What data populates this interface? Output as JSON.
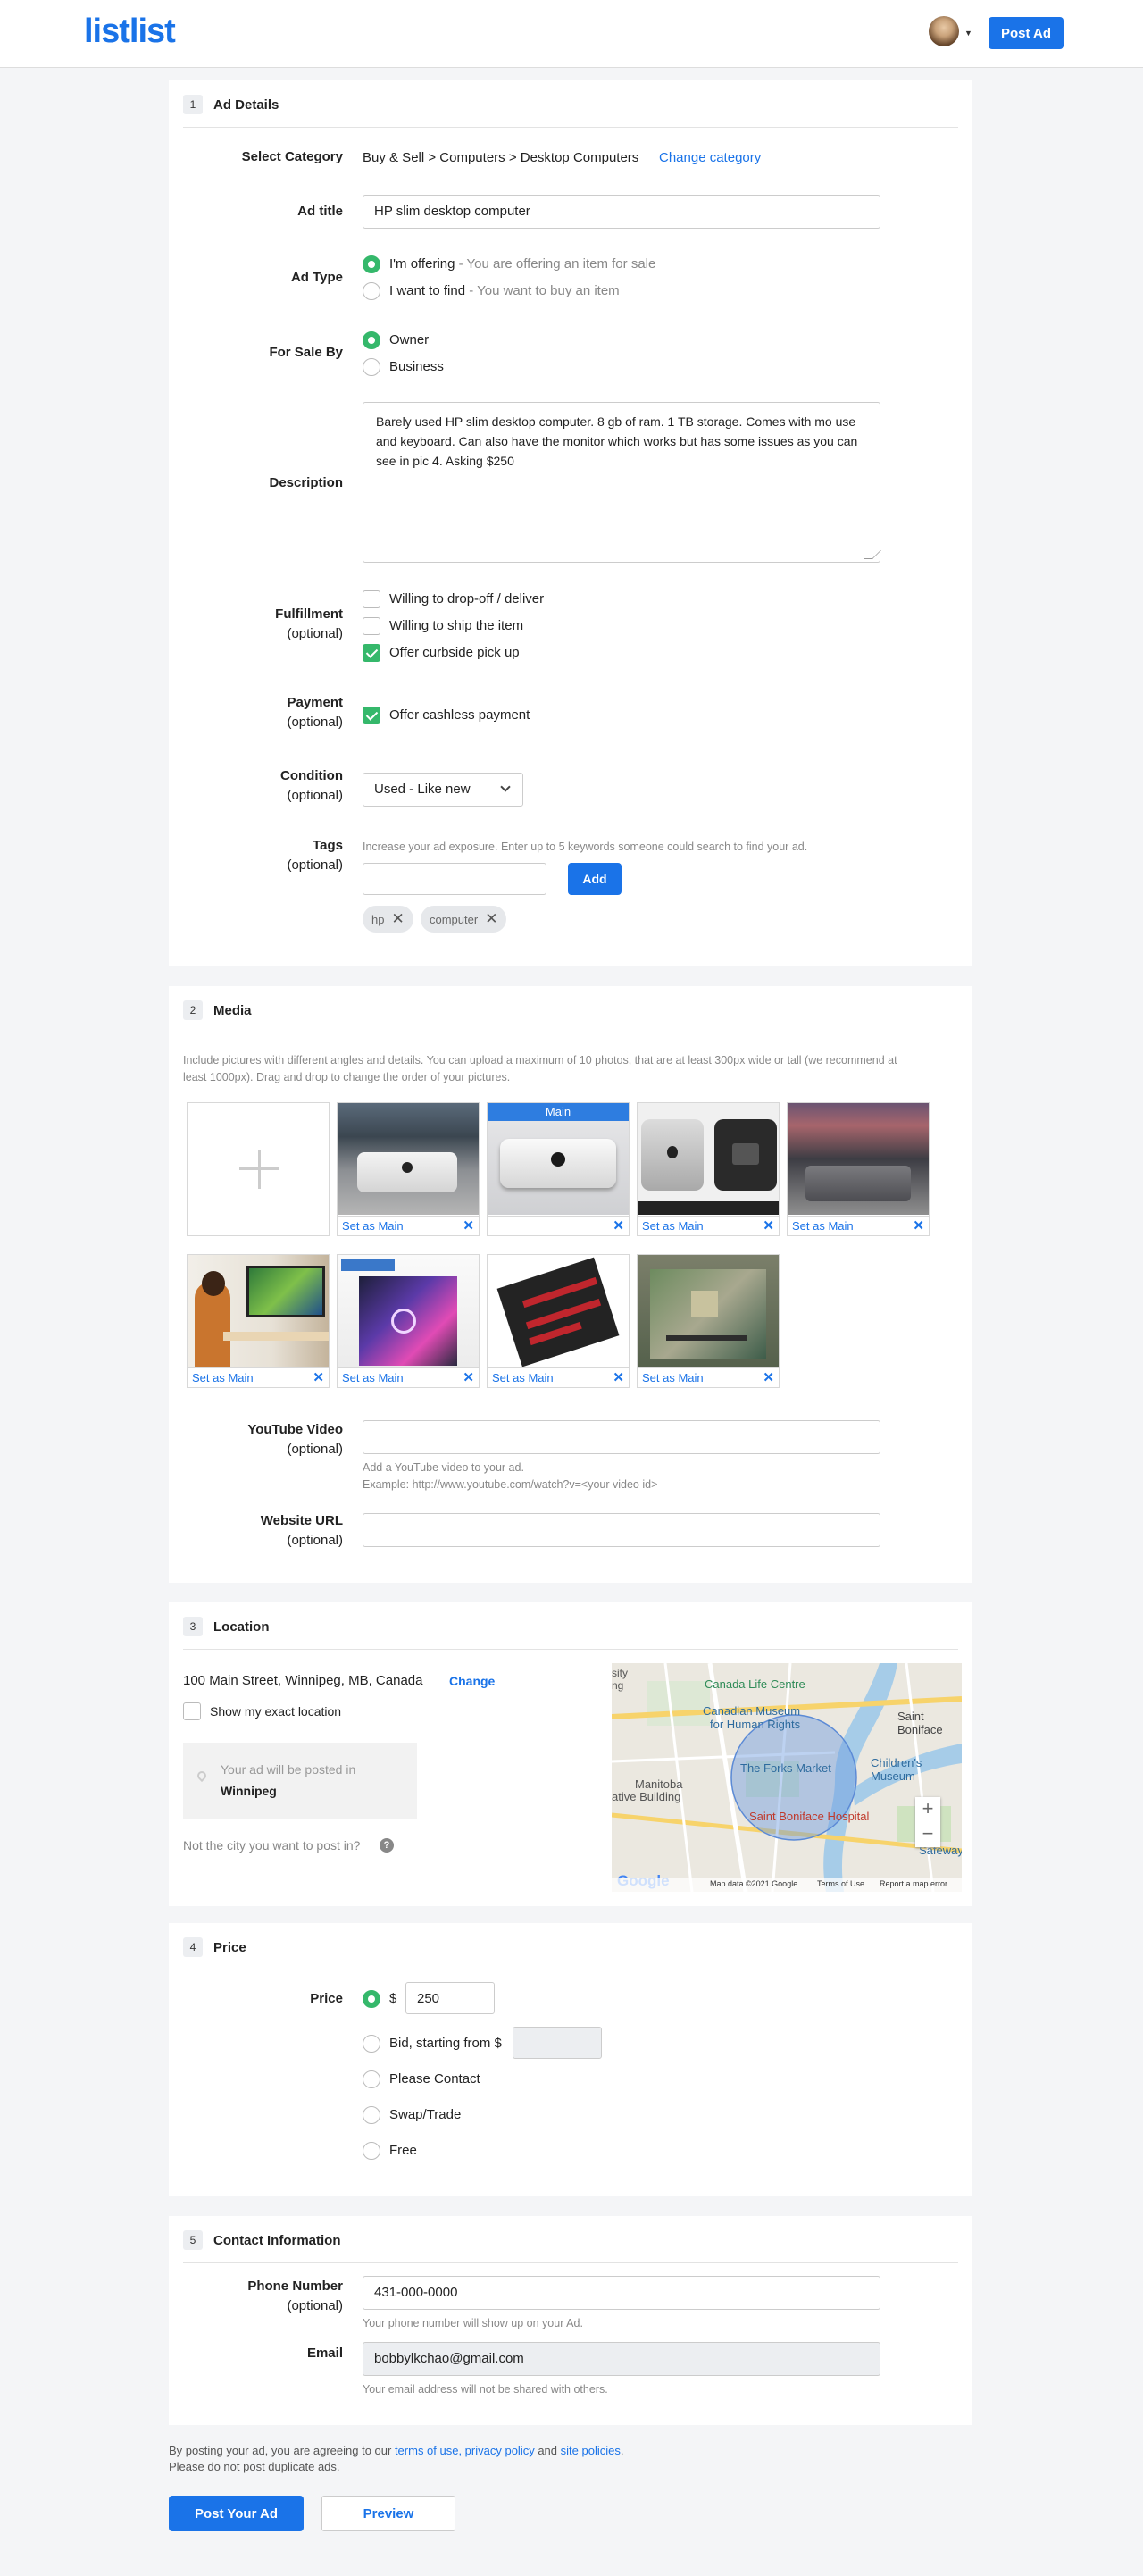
{
  "header": {
    "logo": "listlist",
    "post_ad": "Post Ad"
  },
  "ad_details": {
    "num": "1",
    "title": "Ad Details",
    "category_label": "Select Category",
    "category_path": "Buy & Sell > Computers > Desktop Computers",
    "change_category": "Change category",
    "ad_title_label": "Ad title",
    "ad_title_value": "HP slim desktop computer",
    "ad_type_label": "Ad Type",
    "offering": "I'm offering",
    "offering_hint": " - You are offering an item for sale",
    "find": "I want to find",
    "find_hint": " - You want to buy an item",
    "sale_by_label": "For Sale By",
    "owner": "Owner",
    "business": "Business",
    "description_label": "Description",
    "description_value": "Barely used HP slim desktop computer. 8 gb of ram. 1 TB storage. Comes with mo use and keyboard. Can also have the monitor which works but has some issues as you can see in pic 4. Asking $250",
    "fulfillment_label": "Fulfillment",
    "optional": "(optional)",
    "fulfillment_opts": [
      "Willing to drop-off / deliver",
      "Willing to ship the item",
      "Offer curbside pick up"
    ],
    "payment_label": "Payment",
    "payment_opt": "Offer cashless payment",
    "condition_label": "Condition",
    "condition_value": "Used - Like new",
    "tags_label": "Tags",
    "tags_hint": "Increase your ad exposure. Enter up to 5 keywords someone could search to find your ad.",
    "add": "Add",
    "tags": [
      "hp",
      "computer"
    ]
  },
  "media": {
    "num": "2",
    "title": "Media",
    "hint": "Include pictures with different angles and details. You can upload a maximum of 10 photos, that are at least 300px wide or tall (we recommend at least 1000px). Drag and drop to change the order of your pictures.",
    "set_as_main": "Set as Main",
    "main": "Main",
    "photos": [
      "mac-mini-desk",
      "mac-mini-main",
      "mac-mini-m1x",
      "mac-mini-grey",
      "person-at-pc",
      "gaming-pc-case",
      "motherboard-red",
      "motherboard-green"
    ],
    "youtube_label": "YouTube Video",
    "youtube_hint1": "Add a YouTube video to your ad.",
    "youtube_hint2": "Example: http://www.youtube.com/watch?v=<your video id>",
    "website_label": "Website URL"
  },
  "location": {
    "num": "3",
    "title": "Location",
    "address": "100 Main Street, Winnipeg, MB, Canada",
    "change": "Change",
    "exact": "Show my exact location",
    "posted_in": "Your ad will be posted in",
    "city": "Winnipeg",
    "not_city": "Not the city you want to post in?",
    "map": {
      "labels": [
        "Canada Life Centre",
        "Canadian Museum",
        "for Human Rights",
        "Saint Boniface",
        "Children's Museum",
        "The Forks Market",
        "Manitoba",
        "ative Building",
        "Saint Boniface Hospital",
        "Safeway",
        "sity",
        "ng"
      ],
      "footer": [
        "Map data ©2021 Google",
        "Terms of Use",
        "Report a map error"
      ],
      "google": "Google"
    }
  },
  "price": {
    "num": "4",
    "title": "Price",
    "label": "Price",
    "currency": "$",
    "value": "250",
    "options": [
      "Bid, starting from $",
      "Please Contact",
      "Swap/Trade",
      "Free"
    ]
  },
  "contact": {
    "num": "5",
    "title": "Contact Information",
    "phone_label": "Phone Number",
    "phone_value": "431-000-0000",
    "phone_hint": "Your phone number will show up on your Ad.",
    "email_label": "Email",
    "email_value": "bobbylkchao@gmail.com",
    "email_hint": "Your email address will not be shared with others."
  },
  "footer": {
    "agree_pre": "By posting your ad, you are agreeing to our ",
    "terms": "terms of use, privacy policy",
    "and": " and ",
    "site_policies": "site policies",
    "dot": ".",
    "no_dup": "Please do not post duplicate ads.",
    "post": "Post Your Ad",
    "preview": "Preview"
  },
  "colors": {
    "accent": "#1a73e8",
    "check": "#35b86b",
    "bg": "#f4f5f7"
  }
}
